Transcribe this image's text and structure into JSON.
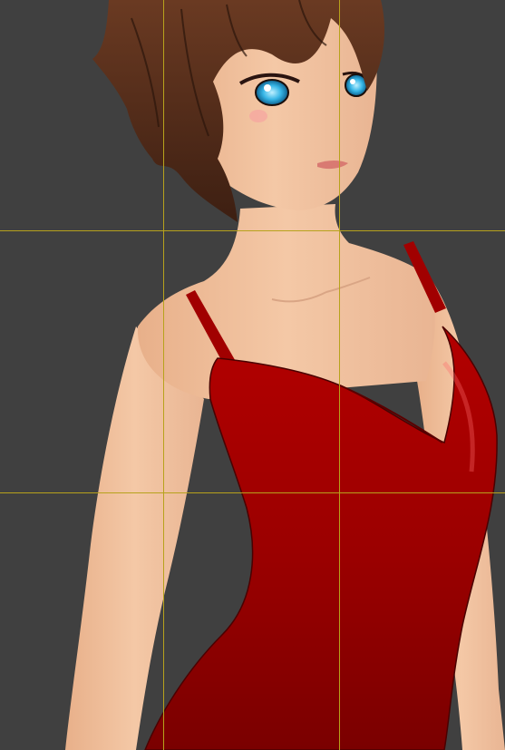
{
  "viewport": {
    "background": "#404040",
    "guide_color": "#b7a21c",
    "overlay": "rule-of-thirds-guides"
  },
  "character": {
    "hair_color": "#5a2f1a",
    "skin_color": "#f2c3a0",
    "eye_color": "#36b5e6",
    "dress_color": "#a10000"
  }
}
